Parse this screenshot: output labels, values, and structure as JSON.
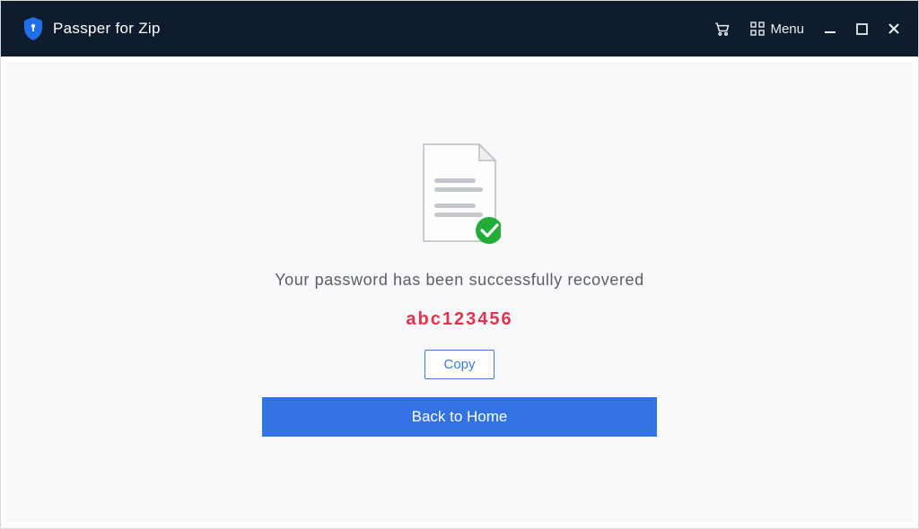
{
  "titlebar": {
    "app_name": "Passper for Zip",
    "menu_label": "Menu"
  },
  "main": {
    "status_message": "Your password has been successfully recovered",
    "recovered_password": "abc123456",
    "copy_label": "Copy",
    "back_home_label": "Back to Home"
  },
  "colors": {
    "titlebar_bg": "#0f1c2e",
    "content_bg": "#f7f9fb",
    "accent_blue": "#3372e2",
    "password_red": "#e3324a",
    "success_green": "#22ac38"
  }
}
